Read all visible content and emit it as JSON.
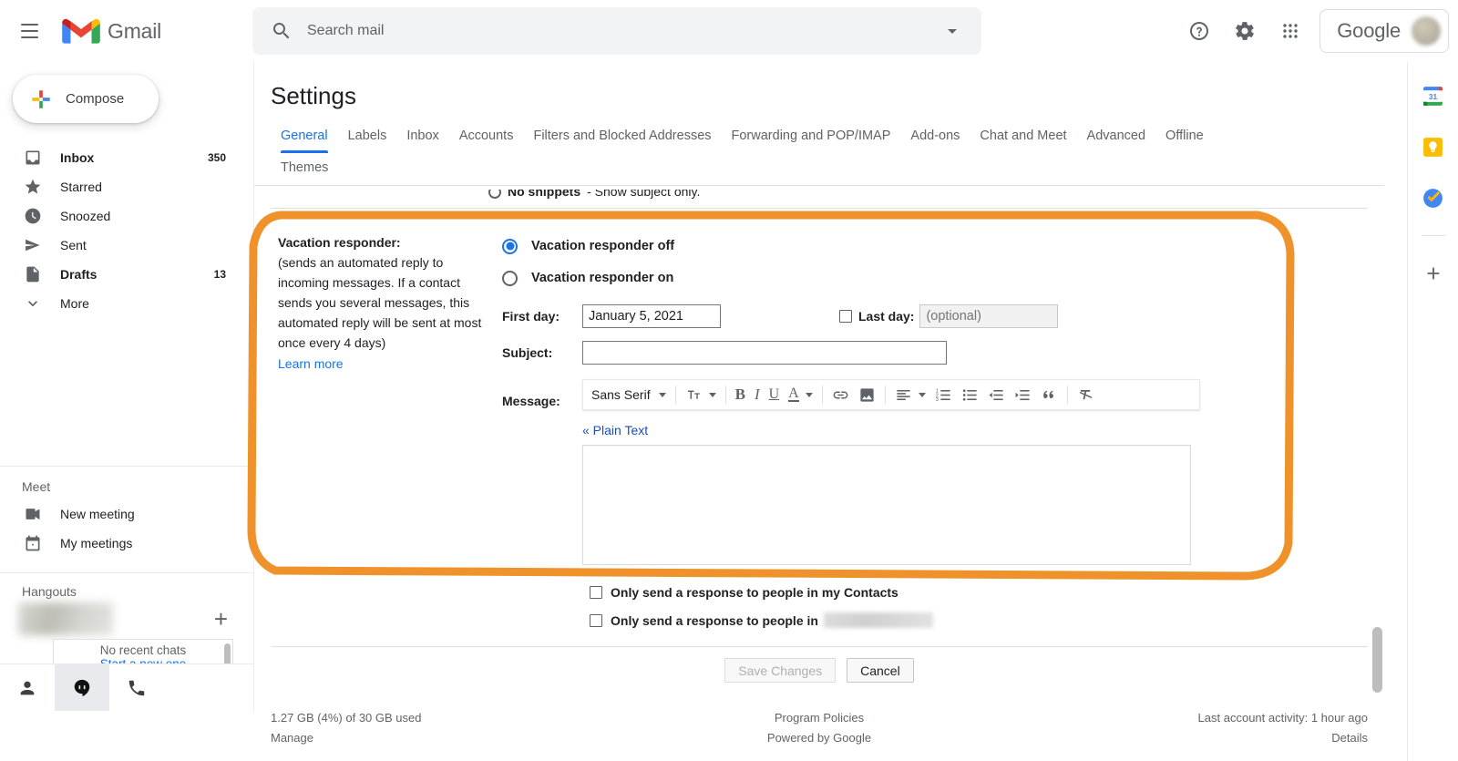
{
  "topbar": {
    "menu_icon": "hamburger-icon",
    "brand": "Gmail",
    "search": {
      "placeholder": "Search mail",
      "value": "",
      "icon": "search-icon",
      "options_icon": "chevron-down-icon"
    },
    "help_icon": "help-icon",
    "settings_icon": "gear-icon",
    "apps_icon": "apps-grid-icon",
    "account_label": "Google",
    "avatar": "avatar-blurred"
  },
  "sidebar": {
    "compose": {
      "label": "Compose",
      "icon": "plus-multicolor-icon"
    },
    "items": [
      {
        "label": "Inbox",
        "count": "350",
        "icon": "inbox-icon",
        "bold": true
      },
      {
        "label": "Starred",
        "count": "",
        "icon": "star-icon",
        "bold": false
      },
      {
        "label": "Snoozed",
        "count": "",
        "icon": "clock-icon",
        "bold": false
      },
      {
        "label": "Sent",
        "count": "",
        "icon": "send-icon",
        "bold": false
      },
      {
        "label": "Drafts",
        "count": "13",
        "icon": "draft-icon",
        "bold": true
      },
      {
        "label": "More",
        "count": "",
        "icon": "chevron-down-icon",
        "bold": false
      }
    ],
    "meet": {
      "title": "Meet",
      "items": [
        {
          "label": "New meeting",
          "icon": "video-camera-icon"
        },
        {
          "label": "My meetings",
          "icon": "calendar-icon"
        }
      ]
    },
    "hangouts": {
      "title": "Hangouts",
      "add_icon": "plus-icon",
      "no_chats": "No recent chats",
      "start_new": "Start a new one"
    },
    "chatbar": [
      {
        "icon": "person-icon",
        "active": false
      },
      {
        "icon": "hangouts-icon",
        "active": true
      },
      {
        "icon": "phone-icon",
        "active": false
      }
    ]
  },
  "settings": {
    "title": "Settings",
    "tabs": [
      {
        "label": "General",
        "active": true
      },
      {
        "label": "Labels",
        "active": false
      },
      {
        "label": "Inbox",
        "active": false
      },
      {
        "label": "Accounts",
        "active": false
      },
      {
        "label": "Filters and Blocked Addresses",
        "active": false
      },
      {
        "label": "Forwarding and POP/IMAP",
        "active": false
      },
      {
        "label": "Add-ons",
        "active": false
      },
      {
        "label": "Chat and Meet",
        "active": false
      },
      {
        "label": "Advanced",
        "active": false
      },
      {
        "label": "Offline",
        "active": false
      },
      {
        "label": "Themes",
        "active": false
      }
    ]
  },
  "snippets_partial": {
    "bold": "No snippets",
    "rest": "- Show subject only."
  },
  "vacation": {
    "label": "Vacation responder:",
    "description": "(sends an automated reply to incoming messages. If a contact sends you several messages, this automated reply will be sent at most once every 4 days)",
    "learn_more": "Learn more",
    "radio_off": {
      "label": "Vacation responder off",
      "selected": true
    },
    "radio_on": {
      "label": "Vacation responder on",
      "selected": false
    },
    "first_day": {
      "label": "First day:",
      "value": "January 5, 2021"
    },
    "last_day": {
      "label": "Last day:",
      "placeholder": "(optional)",
      "value": "",
      "checked": false
    },
    "subject": {
      "label": "Subject:",
      "value": "",
      "placeholder": ""
    },
    "message": {
      "label": "Message:",
      "value": "",
      "plain_text_link": "« Plain Text"
    },
    "toolbar": {
      "font": "Sans Serif",
      "items": [
        {
          "name": "font-family-selector",
          "glyph": "Sans Serif"
        },
        {
          "name": "font-size-icon",
          "glyph": "size"
        },
        {
          "name": "bold-icon",
          "glyph": "B"
        },
        {
          "name": "italic-icon",
          "glyph": "I"
        },
        {
          "name": "underline-icon",
          "glyph": "U"
        },
        {
          "name": "text-color-icon",
          "glyph": "A"
        },
        {
          "name": "insert-link-icon",
          "glyph": "link"
        },
        {
          "name": "insert-image-icon",
          "glyph": "image"
        },
        {
          "name": "align-icon",
          "glyph": "align"
        },
        {
          "name": "numbered-list-icon",
          "glyph": "ol"
        },
        {
          "name": "bulleted-list-icon",
          "glyph": "ul"
        },
        {
          "name": "indent-less-icon",
          "glyph": "outdent"
        },
        {
          "name": "indent-more-icon",
          "glyph": "indent"
        },
        {
          "name": "quote-icon",
          "glyph": "”"
        },
        {
          "name": "remove-formatting-icon",
          "glyph": "clear"
        }
      ]
    },
    "only_contacts": {
      "label": "Only send a response to people in my Contacts",
      "checked": false
    },
    "only_domain": {
      "label": "Only send a response to people in",
      "checked": false,
      "domain_redacted": true
    }
  },
  "actions": {
    "save": {
      "label": "Save Changes",
      "disabled": true
    },
    "cancel": {
      "label": "Cancel",
      "disabled": false
    }
  },
  "footer": {
    "storage": "1.27 GB (4%) of 30 GB used",
    "manage": "Manage",
    "policies": "Program Policies",
    "powered": "Powered by Google",
    "activity": "Last account activity: 1 hour ago",
    "details": "Details"
  },
  "rail": {
    "items": [
      {
        "name": "google-calendar-icon",
        "label": "31"
      },
      {
        "name": "google-keep-icon",
        "label": ""
      },
      {
        "name": "google-tasks-icon",
        "label": ""
      },
      {
        "name": "add-app-icon",
        "label": "+"
      }
    ]
  },
  "annotation": {
    "color": "#F0922B",
    "shape": "rounded-rect-highlight"
  }
}
